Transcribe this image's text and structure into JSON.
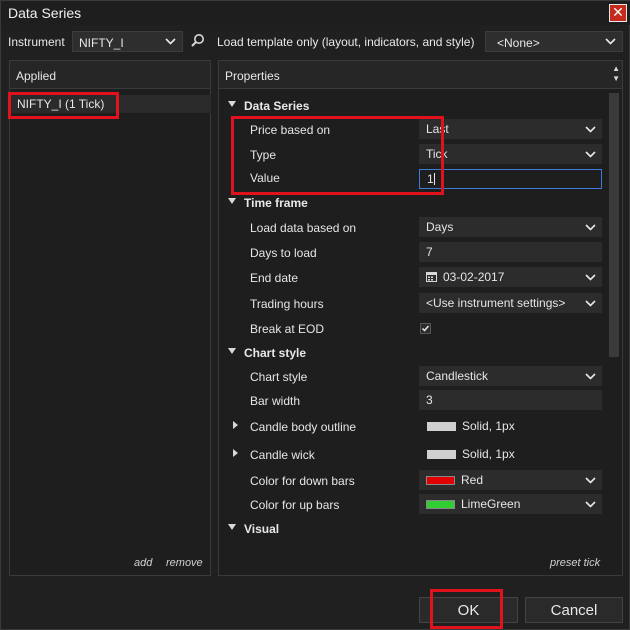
{
  "window": {
    "title": "Data Series",
    "close_icon": "close-icon"
  },
  "topbar": {
    "instrument_label": "Instrument",
    "instrument_value": "NIFTY_I",
    "load_template_label": "Load template only (layout, indicators, and style)",
    "template_value": "<None>"
  },
  "applied": {
    "header": "Applied",
    "items": [
      {
        "label": "NIFTY_I (1 Tick)"
      }
    ],
    "add_label": "add",
    "remove_label": "remove"
  },
  "properties": {
    "header": "Properties",
    "preset_label": "preset tick",
    "categories": {
      "data_series": "Data Series",
      "time_frame": "Time frame",
      "chart_style": "Chart style",
      "visual": "Visual"
    },
    "rows": {
      "price_based_on": {
        "name": "Price based on",
        "value": "Last"
      },
      "type": {
        "name": "Type",
        "value": "Tick"
      },
      "value": {
        "name": "Value",
        "value": "1"
      },
      "load_data_based_on": {
        "name": "Load data based on",
        "value": "Days"
      },
      "days_to_load": {
        "name": "Days to load",
        "value": "7"
      },
      "end_date": {
        "name": "End date",
        "value": "03-02-2017"
      },
      "trading_hours": {
        "name": "Trading hours",
        "value": "<Use instrument settings>"
      },
      "break_at_eod": {
        "name": "Break at EOD",
        "checked": true
      },
      "chart_style": {
        "name": "Chart style",
        "value": "Candlestick"
      },
      "bar_width": {
        "name": "Bar width",
        "value": "3"
      },
      "candle_body_outline": {
        "name": "Candle body outline",
        "value": "Solid, 1px",
        "color": "#d0d0d0"
      },
      "candle_wick": {
        "name": "Candle wick",
        "value": "Solid, 1px",
        "color": "#d0d0d0"
      },
      "color_down_bars": {
        "name": "Color for down bars",
        "value": "Red",
        "color": "#e00000"
      },
      "color_up_bars": {
        "name": "Color for up bars",
        "value": "LimeGreen",
        "color": "#32cd32"
      }
    }
  },
  "buttons": {
    "ok": "OK",
    "cancel": "Cancel"
  },
  "colors": {
    "highlight": "#e0121e",
    "accent": "#3e7bd6"
  }
}
